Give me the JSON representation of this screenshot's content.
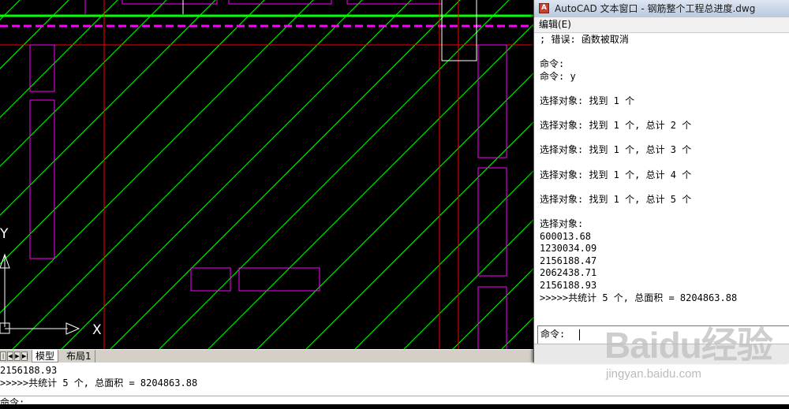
{
  "drawing": {
    "ucs_y_label": "Y",
    "ucs_x_label": "X",
    "colors": {
      "hatch": "#00ff00",
      "magenta": "#ff00ff",
      "red": "#ff0000",
      "white": "#ffffff",
      "background": "#000000"
    }
  },
  "layout_tabs": {
    "nav_buttons": [
      "|◀",
      "◀",
      "▶",
      "▶|"
    ],
    "tabs": [
      {
        "label": "模型",
        "active": true
      },
      {
        "label": "布局1",
        "active": false
      }
    ]
  },
  "command_line": {
    "lines": [
      "2156188.93",
      ">>>>>共统计 5 个, 总面积 = 8204863.88",
      "命令:"
    ]
  },
  "text_window": {
    "title": "AutoCAD 文本窗口 - 钢筋整个工程总进度.dwg",
    "app_icon": "autocad-icon",
    "menu": "编辑(E)",
    "lines": [
      "; 错误: 函数被取消",
      "",
      "命令:",
      "命令: y",
      "",
      "选择对象: 找到 1 个",
      "",
      "选择对象: 找到 1 个, 总计 2 个",
      "",
      "选择对象: 找到 1 个, 总计 3 个",
      "",
      "选择对象: 找到 1 个, 总计 4 个",
      "",
      "选择对象: 找到 1 个, 总计 5 个",
      "",
      "选择对象:",
      "600013.68",
      "1230034.09",
      "2156188.47",
      "2062438.71",
      "2156188.93",
      ">>>>>共统计 5 个, 总面积 = 8204863.88"
    ],
    "command_prompt": "命令:"
  },
  "watermark": {
    "logo": "Baidu经验",
    "url": "jingyan.baidu.com"
  }
}
